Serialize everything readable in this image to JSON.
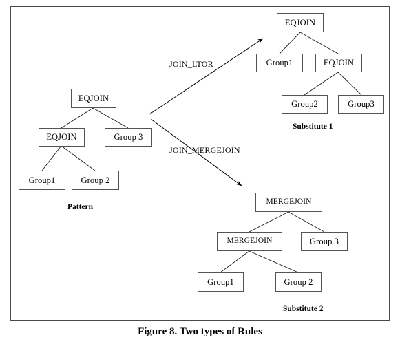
{
  "figure": {
    "caption": "Figure 8. Two types of Rules",
    "border_color": "#4a4a4a",
    "node_border_color": "#545454",
    "background": "#ffffff"
  },
  "pattern": {
    "label": "Pattern",
    "nodes": {
      "root": "EQJOIN",
      "left_child": "EQJOIN",
      "right_child": "Group 3",
      "leaf_left": "Group1",
      "leaf_right": "Group 2"
    }
  },
  "rules": [
    {
      "name": "JOIN_LTOR",
      "target": "Substitute 1"
    },
    {
      "name": "JOIN_MERGEJOIN",
      "target": "Substitute 2"
    }
  ],
  "substitute1": {
    "label": "Substitute 1",
    "nodes": {
      "root": "EQJOIN",
      "left_child": "Group1",
      "right_child": "EQJOIN",
      "leaf_left": "Group2",
      "leaf_right": "Group3"
    }
  },
  "substitute2": {
    "label": "Substitute 2",
    "nodes": {
      "root": "MERGEJOIN",
      "left_child": "MERGEJOIN",
      "right_child": "Group 3",
      "leaf_left": "Group1",
      "leaf_right": "Group 2"
    }
  }
}
